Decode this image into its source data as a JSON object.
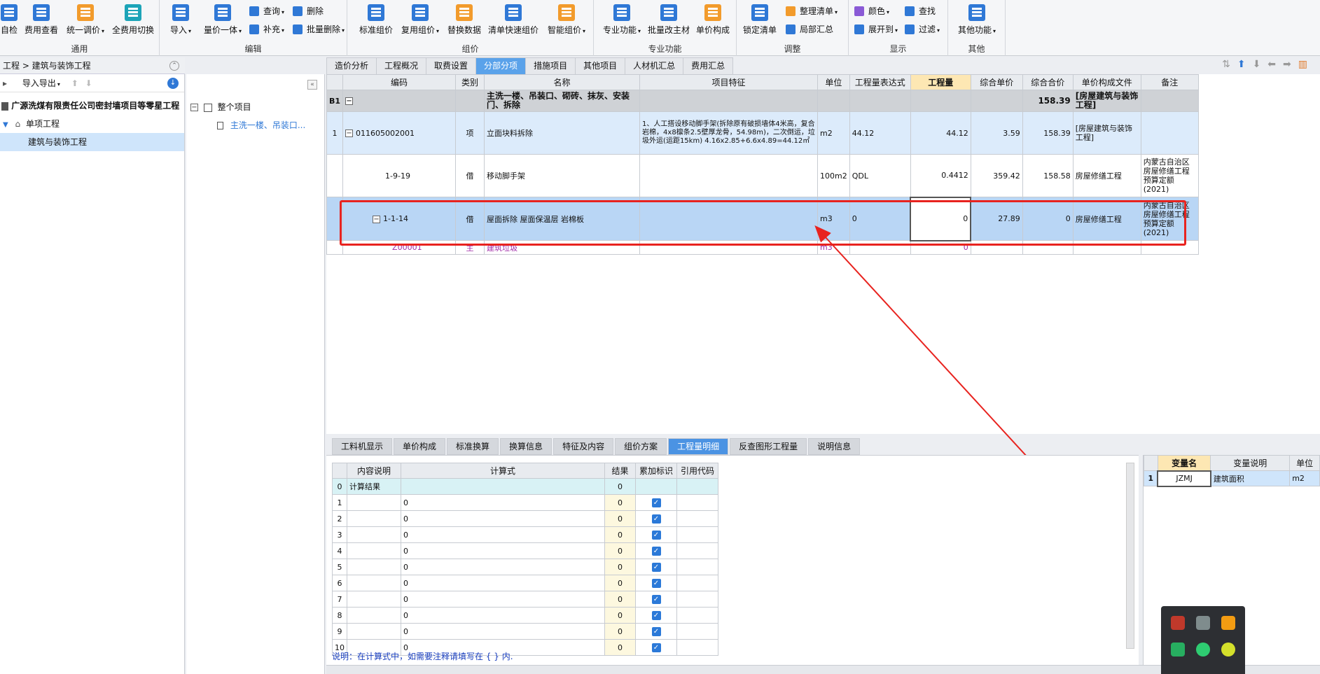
{
  "ribbon": {
    "groups": {
      "general": "通用",
      "edit": "编辑",
      "pricing": "组价",
      "special": "专业功能",
      "adjust": "调整",
      "display": "显示",
      "other": "其他"
    },
    "buttons": {
      "self_check": "自检",
      "fee_view": "费用查看",
      "unify_price": "统一调价",
      "all_fee_switch": "全费用切换",
      "import": "导入",
      "qty_price_one": "量价一体",
      "query": "查询",
      "supplement": "补充",
      "delete": "删除",
      "batch_delete": "批量删除",
      "std_group": "标准组价",
      "reuse_group": "复用组价",
      "replace_data": "替换数据",
      "quick_group": "清单快速组价",
      "smart_group": "智能组价",
      "special_func": "专业功能",
      "batch_main": "批量改主材",
      "unit_price_comp": "单价构成",
      "lock_list": "锁定清单",
      "sort_list": "整理清单",
      "partial_summary": "局部汇总",
      "color": "颜色",
      "expand_to": "展开到",
      "find": "查找",
      "filter": "过滤",
      "other_func": "其他功能"
    }
  },
  "breadcrumb": "工程 > 建筑与装饰工程",
  "left": {
    "import_export": "导入导出",
    "project": "广源洗煤有限责任公司密封墙项目等零星工程",
    "unit_project": "单项工程",
    "sub_project": "建筑与装饰工程"
  },
  "mid_tree": {
    "root": "整个项目",
    "child": "主洗一楼、吊装口..."
  },
  "tabs": [
    "造价分析",
    "工程概况",
    "取费设置",
    "分部分项",
    "措施项目",
    "其他项目",
    "人材机汇总",
    "费用汇总"
  ],
  "grid": {
    "headers": [
      "编码",
      "类别",
      "名称",
      "项目特征",
      "单位",
      "工程量表达式",
      "工程量",
      "综合单价",
      "综合合价",
      "单价构成文件",
      "备注"
    ],
    "b1": {
      "label": "B1",
      "name": "主洗一楼、吊装口、砌砖、抹灰、安装门、拆除",
      "total": "158.39",
      "file": "[房屋建筑与装饰工程]"
    },
    "rows": [
      {
        "no": "1",
        "code": "011605002001",
        "type": "项",
        "name": "立面块料拆除",
        "feature": "1、人工搭设移动脚手架(拆除原有破损墙体4米高，复合岩棉，4x8檩条2.5壁厚龙骨，54.98m)，二次倒运，垃圾外运(运距15km)  4.16x2.85+6.6x4.89=44.12㎡",
        "unit": "m2",
        "expr": "44.12",
        "qty": "44.12",
        "price": "3.59",
        "total": "158.39",
        "file": "[房屋建筑与装饰工程]",
        "remark": ""
      },
      {
        "no": "",
        "code": "1-9-19",
        "type": "借",
        "name": "移动脚手架",
        "feature": "",
        "unit": "100m2",
        "expr": "QDL",
        "qty": "0.4412",
        "price": "359.42",
        "total": "158.58",
        "file": "房屋修缮工程",
        "remark": "内蒙古自治区房屋修缮工程预算定额(2021)"
      },
      {
        "no": "",
        "code": "1-1-14",
        "type": "借",
        "name": "屋面拆除 屋面保温层 岩棉板",
        "feature": "",
        "unit": "m3",
        "expr": "0",
        "qty": "0",
        "price": "27.89",
        "total": "0",
        "file": "房屋修缮工程",
        "remark": "内蒙古自治区房屋修缮工程预算定额(2021)"
      },
      {
        "no": "",
        "code": "Z00001",
        "type": "主",
        "name": "建筑垃圾",
        "feature": "",
        "unit": "m3",
        "expr": "",
        "qty": "0",
        "price": "",
        "total": "",
        "file": "",
        "remark": ""
      }
    ]
  },
  "bottom_tabs": [
    "工料机显示",
    "单价构成",
    "标准换算",
    "换算信息",
    "特征及内容",
    "组价方案",
    "工程量明细",
    "反查图形工程量",
    "说明信息"
  ],
  "calc": {
    "headers": [
      "内容说明",
      "计算式",
      "结果",
      "累加标识",
      "引用代码"
    ],
    "first_row": {
      "no": "0",
      "desc": "计算结果",
      "result": "0"
    },
    "rows": [
      "1",
      "2",
      "3",
      "4",
      "5",
      "6",
      "7",
      "8",
      "9",
      "10"
    ],
    "formula": "0",
    "result": "0"
  },
  "note": "说明：在计算式中，如需要注释请填写在 { } 内.",
  "var_table": {
    "headers": [
      "变量名",
      "变量说明",
      "单位"
    ],
    "row": {
      "no": "1",
      "name": "JZMJ",
      "desc": "建筑面积",
      "unit": "m2"
    }
  },
  "colors": {
    "accent": "#5aa2ea",
    "highlight_border": "#e8231f"
  }
}
